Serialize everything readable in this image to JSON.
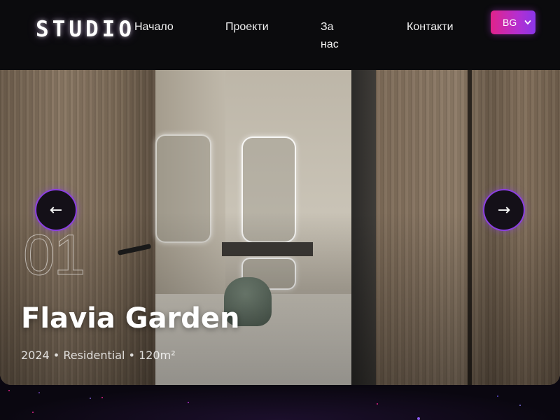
{
  "header": {
    "logo": "STUDIO",
    "nav": {
      "home": "Начало",
      "projects": "Проекти",
      "about": "За нас",
      "contacts": "Контакти"
    },
    "language": {
      "selected": "BG",
      "icon": "chevron-down-icon"
    }
  },
  "hero": {
    "slide_number": "01",
    "project_title": "Flavia Garden",
    "project_meta": "2024 • Residential • 120m²",
    "prev_arrow": "←",
    "next_arrow": "→"
  },
  "colors": {
    "accent_pink": "#e0238a",
    "accent_purple": "#8b3fe0",
    "header_bg": "#0b0b0d",
    "page_bg": "#0a0710"
  }
}
